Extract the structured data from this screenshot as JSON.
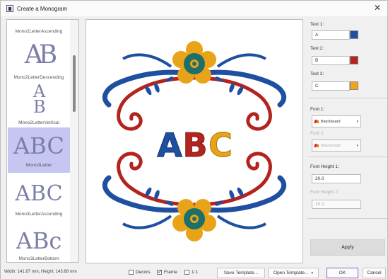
{
  "window": {
    "title": "Create a Monogram",
    "close_icon": "close-icon"
  },
  "styles_list": {
    "items": [
      {
        "glyph": "A",
        "label": "Mono2LetterAscending"
      },
      {
        "glyph": "AB",
        "label": "Mono2LetterDescending"
      },
      {
        "glyph": "AB",
        "label": "Mono2LetterVertical"
      },
      {
        "glyph": "ABC",
        "label": "Mono3Letter",
        "selected": true
      },
      {
        "glyph": "ABC",
        "label": "Mono3LetterAscending"
      },
      {
        "glyph": "ABc",
        "label": "Mono3LetterBottom"
      }
    ]
  },
  "preview": {
    "letters": [
      "A",
      "B",
      "C"
    ],
    "letter_colors": [
      "#1f4fa0",
      "#b3231f",
      "#e9a318"
    ]
  },
  "settings": {
    "text1": {
      "label": "Text 1:",
      "value": "A",
      "color": "#1f4fa0"
    },
    "text2": {
      "label": "Text 2:",
      "value": "B",
      "color": "#b3231f"
    },
    "text3": {
      "label": "Text 3:",
      "value": "C",
      "color": "#f1a31c"
    },
    "font1": {
      "label": "Font 1:",
      "value": "Blackboard"
    },
    "font2": {
      "label": "Font 2:",
      "value": "Blackboard"
    },
    "fontheight1": {
      "label": "Font Height 1:",
      "value": "20.0"
    },
    "fontheight2": {
      "label": "Font Height 2:",
      "value": "10.0"
    },
    "apply_label": "Apply"
  },
  "statusbar": {
    "dimensions": "Width: 141.87 mm, Height: 143.68 mm",
    "decors": {
      "label": "Decors",
      "checked": false
    },
    "frame": {
      "label": "Frame",
      "checked": true
    },
    "one_to_one": {
      "label": "1:1",
      "checked": false
    },
    "save_template": "Save Template...",
    "open_template": "Open Template...",
    "ok": "OK",
    "cancel": "Cancel"
  }
}
